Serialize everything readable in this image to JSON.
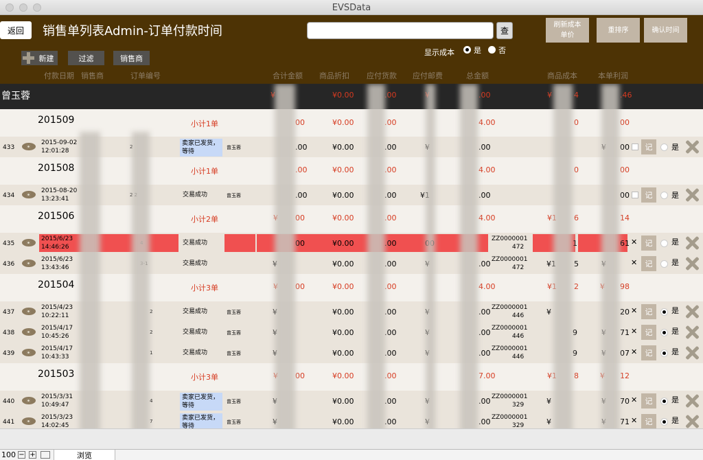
{
  "window": {
    "title": "EVSData"
  },
  "header": {
    "back": "返回",
    "title": "销售单列表Admin-订单付款时间",
    "search_value": "",
    "search_btn": "查",
    "refresh_cost": "刷新成本\n单价",
    "resort": "重排序",
    "confirm_time": "确认时间",
    "show_cost": "显示成本",
    "yes": "是",
    "no": "否",
    "new": "新建",
    "filter": "过滤",
    "seller": "销售商"
  },
  "columns": [
    "付款日期",
    "销售商",
    "订单编号",
    "合计金额",
    "商品折扣",
    "应付货款",
    "应付邮费",
    "总金额",
    "商品成本",
    "本单利润"
  ],
  "group": {
    "name": "曾玉蓉",
    "c1": "¥",
    "discount": "¥0.00",
    "c3": ".00",
    "c5": "¥",
    "c6": ".00",
    "c7": "¥",
    "c8": "4",
    "c9": ".46"
  },
  "subtotals": [
    {
      "month": "201509",
      "label": "小计1单",
      "discount": "¥0.00",
      "c4": ".00",
      "c5": "4.00",
      "c6": "0",
      "c7": "00",
      "c1": "00",
      "c3": ""
    },
    {
      "month": "201508",
      "label": "小计1单",
      "discount": "¥0.00",
      "c4": ".00",
      "c5": "4.00",
      "c6": "0",
      "c7": "00",
      "c1": ".00",
      "c3": ""
    },
    {
      "month": "201506",
      "label": "小计2单",
      "discount": "¥0.00",
      "c4": ".00",
      "c5": "4.00",
      "c6": "¥1",
      "c7": "6",
      "c8": "14",
      "c1": "¥",
      "c2": "00"
    },
    {
      "month": "201504",
      "label": "小计3单",
      "discount": "¥0.00",
      "c4": ".00",
      "c5": "4.00",
      "c6": "¥1",
      "c7": "2",
      "c8": "¥",
      "c9": "98",
      "c1": "¥",
      "c2": "00"
    },
    {
      "month": "201503",
      "label": "小计3单",
      "discount": "¥0.00",
      "c4": ".00",
      "c5": "7.00",
      "c6": "¥1",
      "c7": "8",
      "c8": "¥",
      "c9": "12",
      "c1": "¥",
      "c2": "00"
    }
  ],
  "orders": [
    {
      "id": "433",
      "date": "2015-09-02",
      "time": "12:01:28",
      "code": "2",
      "status": "卖家已发货，等待",
      "seller": "曾玉蓉",
      "amount": ".00",
      "discount": "¥0.00",
      "goods": ".00",
      "post": "¥",
      "total": ".00",
      "sku": "",
      "sku2": "",
      "cost": "",
      "profit": "¥",
      "p2": "00",
      "shi": "是"
    },
    {
      "id": "434",
      "date": "2015-08-20",
      "time": "13:23:41",
      "code": "2   2",
      "status": "交易成功",
      "seller": "曾玉蓉",
      "amount": ".00",
      "discount": "¥0.00",
      "goods": ".00",
      "post": "¥1",
      "total": ".00",
      "sku": "",
      "sku2": "",
      "cost": "",
      "profit": "",
      "p2": "00",
      "shi": "是"
    },
    {
      "id": "435",
      "date": "2015/6/23",
      "time": "14:46:26",
      "code": "4",
      "status": "交易成功",
      "seller": "",
      "amount": "00",
      "discount": "¥0.00",
      "goods": ".00",
      "post": "00",
      "total": "",
      "sku": "ZZ0000001",
      "sku2": "472",
      "cost": "1",
      "profit": "61",
      "p2": "",
      "shi": "是"
    },
    {
      "id": "436",
      "date": "2015/6/23",
      "time": "13:43:46",
      "code": "3-1",
      "status": "交易成功",
      "seller": "",
      "amount": "¥",
      "discount": "¥0.00",
      "goods": ".00",
      "post": "¥",
      "total": ".00",
      "sku": "ZZ0000001",
      "sku2": "472",
      "cost": "¥1",
      "profit": "5",
      "p2": "¥",
      "shi": "是"
    },
    {
      "id": "437",
      "date": "2015/4/23",
      "time": "10:22:11",
      "code": "2",
      "status": "交易成功",
      "seller": "曾玉蓉",
      "amount": "¥",
      "discount": "¥0.00",
      "goods": ".00",
      "post": "¥",
      "total": ".00",
      "sku": "ZZ0000001",
      "sku2": "446",
      "cost": "¥",
      "profit": "20",
      "p2": "",
      "shi": "是"
    },
    {
      "id": "438",
      "date": "2015/4/17",
      "time": "10:45:26",
      "code": "2",
      "status": "交易成功",
      "seller": "曾玉蓉",
      "amount": "¥",
      "discount": "¥0.00",
      "goods": ".00",
      "post": "¥",
      "total": ".00",
      "sku": "ZZ0000001",
      "sku2": "446",
      "cost": "9",
      "profit": "¥",
      "p2": "71",
      "shi": "是"
    },
    {
      "id": "439",
      "date": "2015/4/17",
      "time": "10:43:33",
      "code": "1",
      "status": "交易成功",
      "seller": "曾玉蓉",
      "amount": "¥",
      "discount": "¥0.00",
      "goods": ".00",
      "post": "¥",
      "total": ".00",
      "sku": "ZZ0000001",
      "sku2": "446",
      "cost": "9",
      "profit": "¥",
      "p2": "07",
      "shi": "是"
    },
    {
      "id": "440",
      "date": "2015/3/31",
      "time": "10:49:47",
      "code": "4",
      "status": "卖家已发货，等待",
      "seller": "曾玉蓉",
      "amount": "¥",
      "discount": "¥0.00",
      "goods": ".00",
      "post": "¥",
      "total": ".00",
      "sku": "ZZ0000001",
      "sku2": "329",
      "cost": "¥",
      "profit": "¥",
      "p2": "70",
      "shi": "是"
    },
    {
      "id": "441",
      "date": "2015/3/23",
      "time": "14:02:45",
      "code": "7",
      "status": "卖家已发货，等待",
      "seller": "曾玉蓉",
      "amount": "¥",
      "discount": "¥0.00",
      "goods": ".00",
      "post": "¥",
      "total": ".00",
      "sku": "ZZ0000001",
      "sku2": "329",
      "cost": "¥",
      "profit": "¥",
      "p2": "71",
      "shi": "是"
    }
  ],
  "statusbar": {
    "zoom": "100",
    "mode": "浏览"
  }
}
